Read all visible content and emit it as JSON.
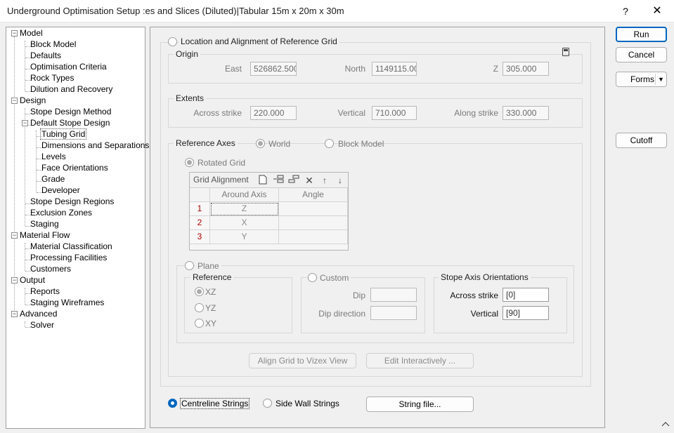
{
  "window": {
    "title": "Underground Optimisation Setup :es and Slices (Diluted)|Tabular 15m x 20m x 30m",
    "help": "?",
    "close": "✕"
  },
  "tree": {
    "model": "Model",
    "block_model": "Block Model",
    "defaults": "Defaults",
    "optimisation_criteria": "Optimisation Criteria",
    "rock_types": "Rock Types",
    "dilution_recovery": "Dilution and Recovery",
    "design": "Design",
    "stope_design_method": "Stope Design Method",
    "default_stope_design": "Default Stope Design",
    "tubing_grid": "Tubing Grid",
    "dimensions_separations": "Dimensions and Separations",
    "levels": "Levels",
    "face_orientations": "Face Orientations",
    "grade": "Grade",
    "developer": "Developer",
    "stope_design_regions": "Stope Design Regions",
    "exclusion_zones": "Exclusion Zones",
    "staging": "Staging",
    "material_flow": "Material Flow",
    "material_classification": "Material Classification",
    "processing_facilities": "Processing Facilities",
    "customers": "Customers",
    "output": "Output",
    "reports": "Reports",
    "staging_wireframes": "Staging Wireframes",
    "advanced": "Advanced",
    "solver": "Solver"
  },
  "main": {
    "location_title": "Location and Alignment of Reference Grid",
    "origin": {
      "title": "Origin",
      "east_label": "East",
      "east_value": "526862.500",
      "north_label": "North",
      "north_value": "1149115.00",
      "z_label": "Z",
      "z_value": "305.000"
    },
    "extents": {
      "title": "Extents",
      "across_label": "Across strike",
      "across_value": "220.000",
      "vertical_label": "Vertical",
      "vertical_value": "710.000",
      "along_label": "Along strike",
      "along_value": "330.000"
    },
    "reference_axes": {
      "title": "Reference Axes",
      "world": "World",
      "block_model": "Block Model",
      "rotated_grid": "Rotated Grid"
    },
    "grid_alignment": {
      "title": "Grid Alignment",
      "col_axis": "Around Axis",
      "col_angle": "Angle",
      "rows": [
        {
          "num": "1",
          "axis": "Z",
          "angle": ""
        },
        {
          "num": "2",
          "axis": "X",
          "angle": ""
        },
        {
          "num": "3",
          "axis": "Y",
          "angle": ""
        }
      ]
    },
    "plane": {
      "title": "Plane",
      "reference_title": "Reference",
      "xz": "XZ",
      "yz": "YZ",
      "xy": "XY",
      "custom": "Custom",
      "dip_label": "Dip",
      "dip_direction_label": "Dip direction",
      "stope_axis_title": "Stope Axis Orientations",
      "across_label": "Across strike",
      "across_value": "[0]",
      "vertical_label": "Vertical",
      "vertical_value": "[90]"
    },
    "align_button": "Align Grid to Vizex View",
    "edit_button": "Edit Interactively ...",
    "centreline": "Centreline Strings",
    "side_wall": "Side Wall Strings",
    "string_file": "String file..."
  },
  "buttons": {
    "run": "Run",
    "cancel": "Cancel",
    "forms": "Forms",
    "cutoff": "Cutoff"
  },
  "colors": {
    "accent": "#0067c0",
    "row_number": "#aa0000"
  }
}
